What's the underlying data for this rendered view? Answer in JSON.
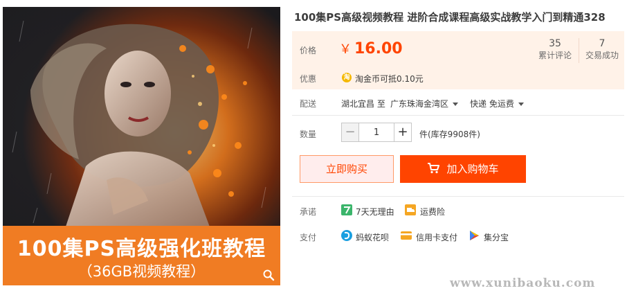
{
  "product": {
    "title": "100集PS高级视频教程 进阶合成课程高级实战教学入门到精通328",
    "image": {
      "banner_title": "100集PS高级强化班教程",
      "banner_subtitle": "（36GB视频教程）",
      "zoom_icon": "search-icon"
    }
  },
  "price": {
    "label": "价格",
    "currency": "￥",
    "value": "16.00",
    "reviews_count": "35",
    "reviews_label": "累计评论",
    "sales_count": "7",
    "sales_label": "交易成功"
  },
  "promo": {
    "label": "优惠",
    "icon_glyph": "淘",
    "text": "淘金币可抵0.10元"
  },
  "shipping": {
    "label": "配送",
    "from": "湖北宜昌",
    "to_word": "至",
    "destination": "广东珠海金湾区",
    "method": "快递 免运费"
  },
  "quantity": {
    "label": "数量",
    "minus": "−",
    "value": "1",
    "plus": "+",
    "stock_text": "件(库存9908件)"
  },
  "actions": {
    "buy_now": "立即购买",
    "add_to_cart": "加入购物车"
  },
  "services": {
    "label": "承诺",
    "items": [
      {
        "icon": "seven-day-return-icon",
        "text": "7天无理由"
      },
      {
        "icon": "shipping-insurance-icon",
        "text": "运费险"
      }
    ]
  },
  "payment": {
    "label": "支付",
    "items": [
      {
        "icon": "huabei-icon",
        "text": "蚂蚁花呗"
      },
      {
        "icon": "credit-card-icon",
        "text": "信用卡支付"
      },
      {
        "icon": "jifenbao-icon",
        "text": "集分宝"
      }
    ]
  },
  "watermark": "www.xunibaoku.com",
  "colors": {
    "accent": "#ff4400",
    "price_bg": "#fff2e8",
    "banner": "#f07c23"
  }
}
